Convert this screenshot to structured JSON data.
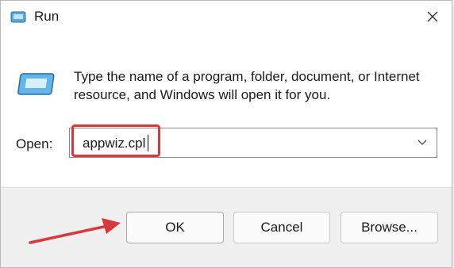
{
  "window": {
    "title": "Run",
    "close_icon": "close-icon",
    "app_icon": "run-icon"
  },
  "content": {
    "description": "Type the name of a program, folder, document, or Internet resource, and Windows will open it for you.",
    "open_label": "Open:",
    "open_value": "appwiz.cpl",
    "dropdown_icon": "chevron-down-icon"
  },
  "buttons": {
    "ok": "OK",
    "cancel": "Cancel",
    "browse": "Browse..."
  },
  "annotation": {
    "highlight_color": "#d9393d",
    "arrow_color": "#d9393d"
  }
}
